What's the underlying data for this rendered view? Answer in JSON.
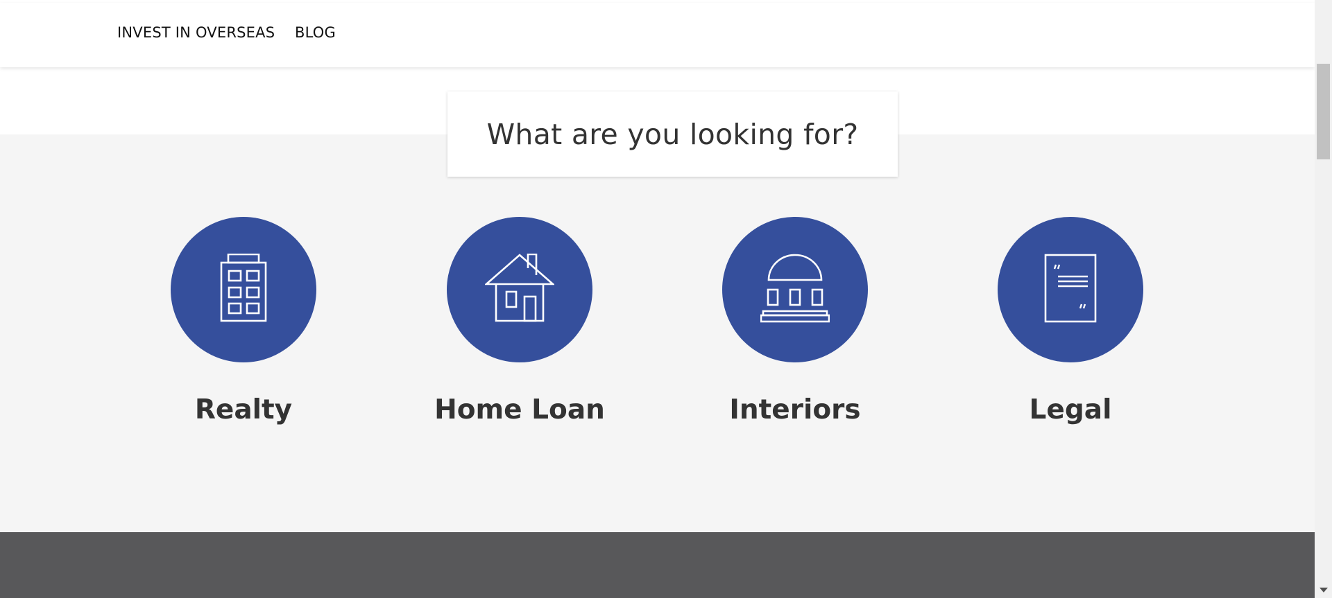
{
  "nav": {
    "items": [
      {
        "label": "INVEST IN OVERSEAS"
      },
      {
        "label": "BLOG"
      }
    ]
  },
  "heading": "What are you looking for?",
  "services": [
    {
      "label": "Realty",
      "icon": "building-icon"
    },
    {
      "label": "Home Loan",
      "icon": "house-icon"
    },
    {
      "label": "Interiors",
      "icon": "dome-building-icon"
    },
    {
      "label": "Legal",
      "icon": "document-quote-icon"
    }
  ],
  "colors": {
    "accent": "#354f9c",
    "heading_text": "#333333",
    "section_bg": "#f5f5f5",
    "footer_bg": "#58585a"
  }
}
